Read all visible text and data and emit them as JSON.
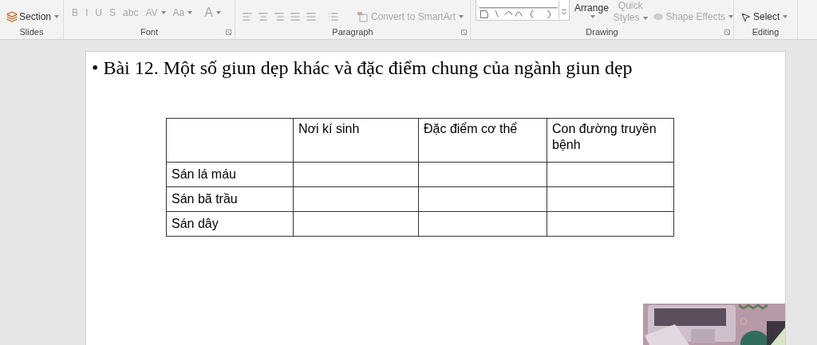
{
  "ribbon": {
    "slides": {
      "section_button": "Section",
      "label": "Slides"
    },
    "font": {
      "buttons": [
        {
          "label": "B",
          "dropdown": false
        },
        {
          "label": "I",
          "dropdown": false
        },
        {
          "label": "U",
          "dropdown": false
        },
        {
          "label": "S",
          "dropdown": false
        },
        {
          "label": "abc",
          "dropdown": false
        },
        {
          "label": "AV",
          "dropdown": true
        },
        {
          "label": "Aa",
          "dropdown": true
        },
        {
          "label": "A",
          "dropdown": true
        }
      ],
      "label": "Font"
    },
    "paragraph": {
      "smartart_button": "Convert to SmartArt",
      "label": "Paragraph"
    },
    "drawing": {
      "arrange_button": "Arrange",
      "quick_styles_button": [
        "Quick",
        "Styles"
      ],
      "shape_effects_button": "Shape Effects",
      "label": "Drawing"
    },
    "editing": {
      "select_button": "Select",
      "label": "Editing"
    }
  },
  "slide": {
    "bullet": "•",
    "title": "Bài 12. Một số giun dẹp khác và đặc điểm chung của ngành giun dẹp",
    "table": {
      "columns": [
        "",
        "Nơi kí sinh",
        "Đặc điểm cơ thể",
        "Con đường truyền bệnh"
      ],
      "rows": [
        [
          "Sán lá máu",
          "",
          "",
          ""
        ],
        [
          "Sán bã trầu",
          "",
          "",
          ""
        ],
        [
          "Sán dây",
          "",
          "",
          ""
        ]
      ]
    }
  }
}
